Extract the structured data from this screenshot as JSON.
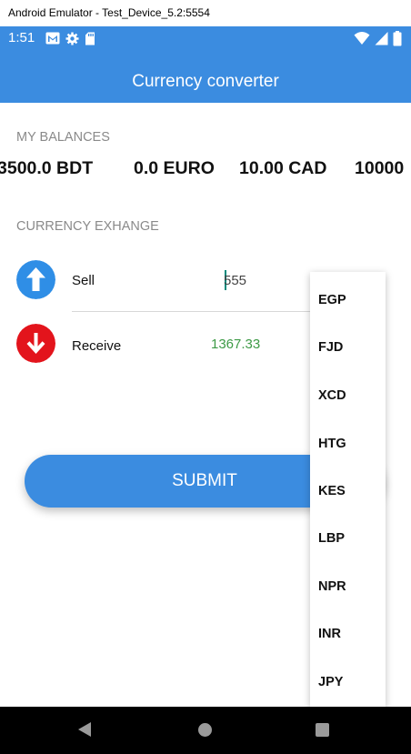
{
  "window": {
    "title": "Android Emulator - Test_Device_5.2:5554"
  },
  "status_bar": {
    "time": "1:51",
    "left_icons": [
      "gmail-icon",
      "settings-gear-icon",
      "sd-card-icon"
    ],
    "right_icons": [
      "wifi-icon",
      "signal-icon",
      "battery-icon"
    ]
  },
  "app_bar": {
    "title": "Currency converter",
    "color": "#3b8ce0"
  },
  "balances": {
    "header": "MY BALANCES",
    "items": [
      "3500.0 BDT",
      "0.0 EURO",
      "10.00 CAD",
      "10000"
    ]
  },
  "exchange": {
    "header": "CURRENCY EXHANGE",
    "sell": {
      "label": "Sell",
      "value": "555",
      "icon": "arrow-up-icon",
      "icon_color": "#2f8ee6"
    },
    "receive": {
      "label": "Receive",
      "value": "1367.33",
      "icon": "arrow-down-icon",
      "icon_color": "#e3141c",
      "value_color": "#3d9a46"
    }
  },
  "submit": {
    "label": "SUBMIT"
  },
  "currency_dropdown": {
    "options": [
      "EGP",
      "FJD",
      "XCD",
      "HTG",
      "KES",
      "LBP",
      "NPR",
      "INR",
      "JPY"
    ]
  },
  "nav_bar": {
    "buttons": [
      "back-icon",
      "home-icon",
      "recent-apps-icon"
    ]
  }
}
